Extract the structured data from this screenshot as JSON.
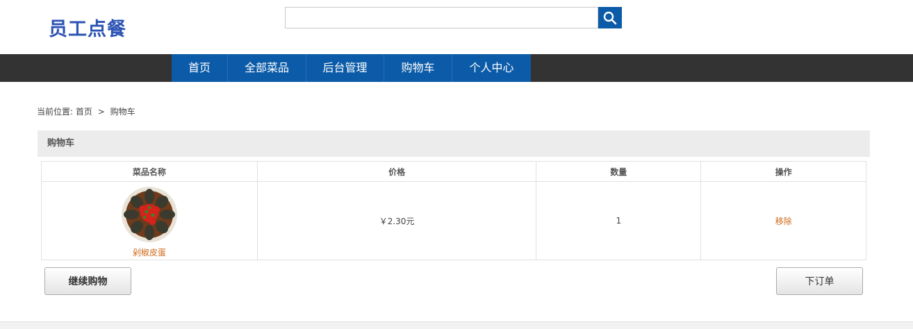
{
  "header": {
    "logo": "员工点餐",
    "search": {
      "value": "",
      "placeholder": ""
    }
  },
  "nav": [
    {
      "label": "首页"
    },
    {
      "label": "全部菜品"
    },
    {
      "label": "后台管理"
    },
    {
      "label": "购物车"
    },
    {
      "label": "个人中心"
    }
  ],
  "breadcrumb": {
    "prefix": "当前位置:",
    "home": "首页",
    "separator": ">",
    "current": "购物车"
  },
  "cart": {
    "title": "购物车",
    "columns": [
      "菜品名称",
      "价格",
      "数量",
      "操作"
    ],
    "rows": [
      {
        "name": "剁椒皮蛋",
        "price": "￥2.30元",
        "quantity": "1",
        "action": "移除"
      }
    ]
  },
  "buttons": {
    "continue": "继续购物",
    "order": "下订单"
  },
  "colors": {
    "brand": "#2b52b4",
    "nav_active": "#0b5ba8",
    "navbar": "#333333",
    "link": "#d06a1a"
  }
}
